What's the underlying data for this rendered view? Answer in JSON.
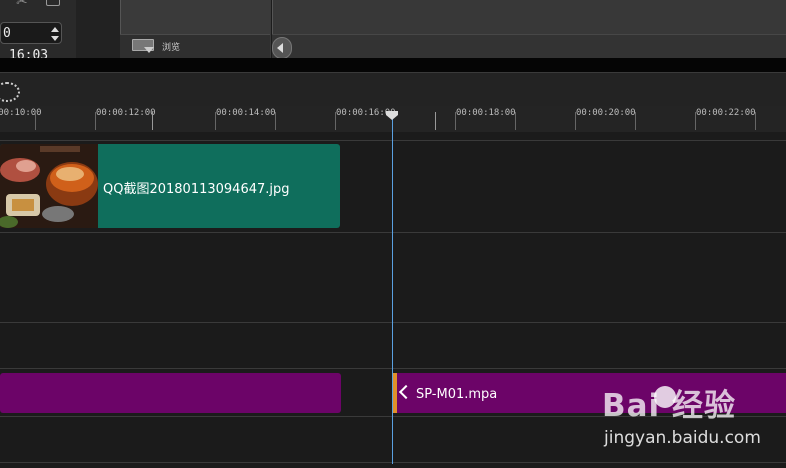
{
  "header": {
    "timecode": "16:03",
    "timecode_prefix": "0",
    "preview_label": "浏览"
  },
  "ruler": {
    "ticks": [
      "00:00:10:00",
      "00:00:12:00",
      "00:00:14:00",
      "00:00:16:00",
      "00:00:18:00",
      "00:00:20:00",
      "00:00:22:00"
    ]
  },
  "tracks": {
    "video_clip": {
      "label": "QQ截图20180113094647.jpg"
    },
    "audio_clip_right": {
      "label": "SP-M01.mpa"
    }
  },
  "watermark": {
    "brand": "Bai 经验",
    "url": "jingyan.baidu.com"
  },
  "colors": {
    "video_clip": "#0f6e5c",
    "audio_clip": "#6c0468",
    "playhead": "#5aa0e0",
    "clip_edge": "#e0902a"
  }
}
